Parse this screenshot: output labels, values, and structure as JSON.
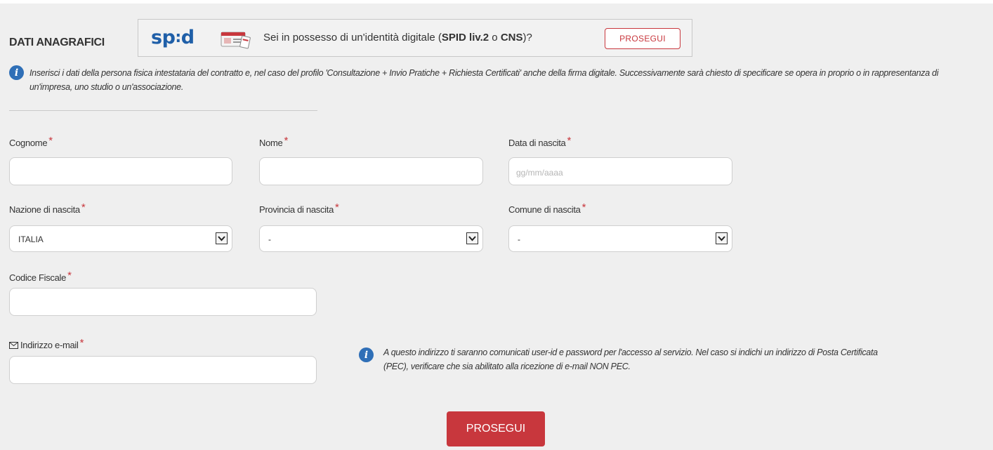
{
  "section": {
    "title": "DATI ANAGRAFICI"
  },
  "spid": {
    "logo_text": "spid",
    "prompt_prefix": "Sei in possesso di un'identità digitale (",
    "prompt_spid": "SPID liv.2",
    "prompt_mid": " o ",
    "prompt_cns": "CNS",
    "prompt_suffix": ")?",
    "button_label": "PROSEGUI"
  },
  "info_top": {
    "icon": "info-icon",
    "text": "Inserisci i dati della persona fisica intestataria del contratto e, nel caso del profilo 'Consultazione + Invio Pratiche + Richiesta Certificati' anche della firma digitale. Successivamente sarà chiesto di specificare se opera in proprio o in rappresentanza di un'impresa, uno studio o un'associazione."
  },
  "form": {
    "required_mark": "*",
    "cognome": {
      "label": "Cognome",
      "value": ""
    },
    "nome": {
      "label": "Nome",
      "value": ""
    },
    "data_nascita": {
      "label": "Data di nascita",
      "placeholder": "gg/mm/aaaa",
      "value": ""
    },
    "nazione": {
      "label": "Nazione di nascita",
      "value": "ITALIA"
    },
    "provincia": {
      "label": "Provincia di nascita",
      "value": "-"
    },
    "comune": {
      "label": "Comune di nascita",
      "value": "-"
    },
    "codice_fiscale": {
      "label": "Codice Fiscale",
      "value": ""
    },
    "email": {
      "label": "Indirizzo e-mail",
      "icon": "envelope-icon",
      "value": ""
    }
  },
  "info_email": {
    "icon": "info-icon",
    "text": "A questo indirizzo ti saranno comunicati user-id e password per l'accesso al servizio. Nel caso si indichi un indirizzo di Posta Certificata (PEC), verificare che sia abilitato alla ricezione di e-mail NON PEC."
  },
  "submit": {
    "label": "PROSEGUI"
  },
  "colors": {
    "accent": "#c8373d",
    "info": "#2f6fb7",
    "spid_blue": "#1f5fa8",
    "panel": "#efefef"
  }
}
